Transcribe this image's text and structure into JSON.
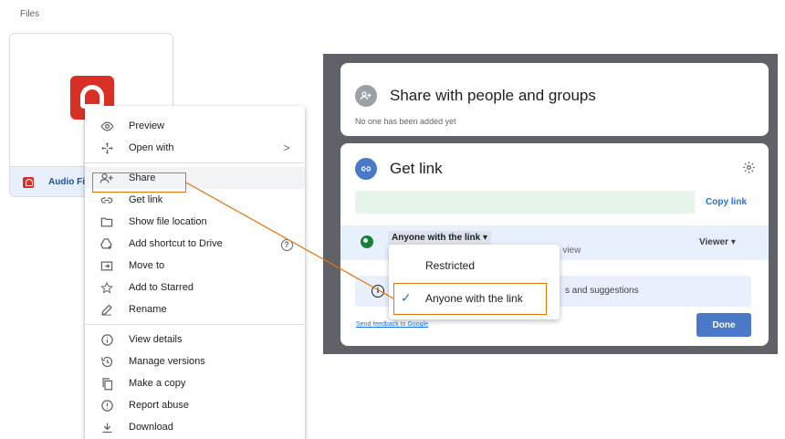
{
  "page": {
    "section_title": "Files"
  },
  "file": {
    "name": "Audio File"
  },
  "context_menu": {
    "items": [
      {
        "label": "Preview",
        "icon": "eye-icon"
      },
      {
        "label": "Open with",
        "icon": "move-arrows-icon",
        "right": ">"
      },
      {
        "label": "Share",
        "icon": "person-add-icon"
      },
      {
        "label": "Get link",
        "icon": "link-icon"
      },
      {
        "label": "Show file location",
        "icon": "folder-icon"
      },
      {
        "label": "Add shortcut to Drive",
        "icon": "drive-shortcut-icon",
        "right": "?"
      },
      {
        "label": "Move to",
        "icon": "move-to-folder-icon"
      },
      {
        "label": "Add to Starred",
        "icon": "star-icon"
      },
      {
        "label": "Rename",
        "icon": "pencil-icon"
      },
      {
        "label": "View details",
        "icon": "info-icon"
      },
      {
        "label": "Manage versions",
        "icon": "history-icon"
      },
      {
        "label": "Make a copy",
        "icon": "copy-icon"
      },
      {
        "label": "Report abuse",
        "icon": "alert-icon"
      },
      {
        "label": "Download",
        "icon": "download-icon"
      }
    ]
  },
  "share_dialog": {
    "people_title": "Share with people and groups",
    "people_subtitle": "No one has been added yet",
    "link_title": "Get link",
    "copy_link": "Copy link",
    "access_label": "Anyone with the link",
    "access_caret": "▾",
    "access_desc_partial": "n view",
    "role": "Viewer",
    "role_caret": "▾",
    "info_partial": "s and suggestions",
    "feedback": "Send feedback to Google",
    "done": "Done"
  },
  "access_dropdown": {
    "options": [
      {
        "label": "Restricted",
        "selected": false
      },
      {
        "label": "Anyone with the link",
        "selected": true
      }
    ]
  },
  "colors": {
    "accent": "#1a73e8",
    "done_button": "#4a79c7",
    "annotation": "#e8710a",
    "file_icon": "#d93025",
    "selected_file_bg": "#e8f0fe",
    "link_field_bg": "#e6f4ea"
  }
}
